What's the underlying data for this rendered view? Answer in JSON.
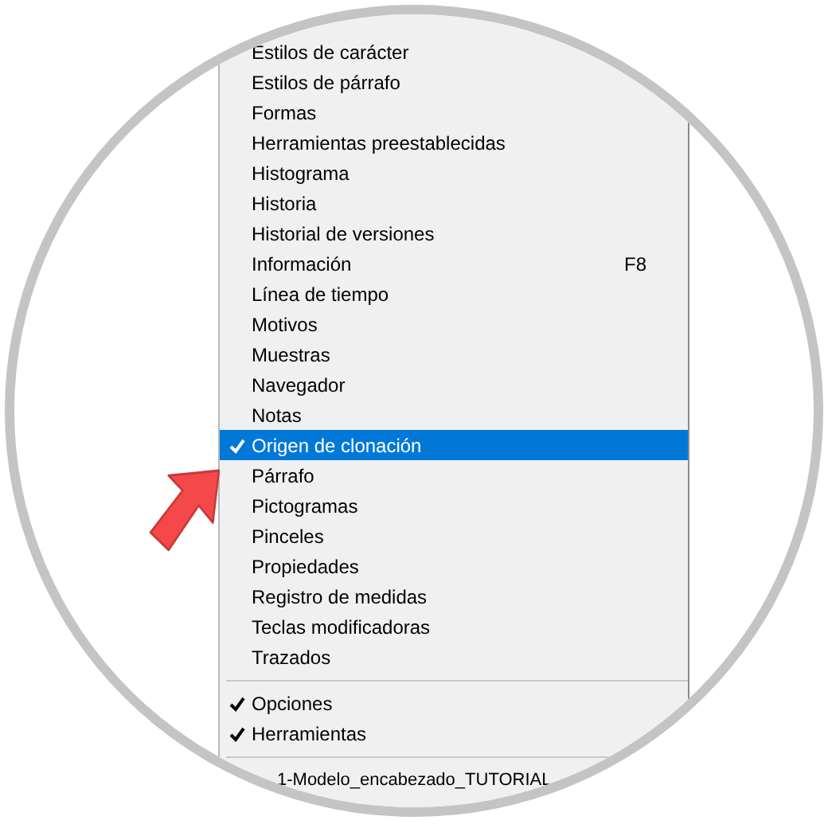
{
  "menu": {
    "items": [
      {
        "kind": "item",
        "label": "Estilos de carácter",
        "checked": false,
        "selected": false
      },
      {
        "kind": "item",
        "label": "Estilos de párrafo",
        "checked": false,
        "selected": false
      },
      {
        "kind": "item",
        "label": "Formas",
        "checked": false,
        "selected": false
      },
      {
        "kind": "item",
        "label": "Herramientas preestablecidas",
        "checked": false,
        "selected": false
      },
      {
        "kind": "item",
        "label": "Histograma",
        "checked": false,
        "selected": false
      },
      {
        "kind": "item",
        "label": "Historia",
        "checked": false,
        "selected": false
      },
      {
        "kind": "item",
        "label": "Historial de versiones",
        "checked": false,
        "selected": false
      },
      {
        "kind": "item",
        "label": "Información",
        "shortcut": "F8",
        "checked": false,
        "selected": false
      },
      {
        "kind": "item",
        "label": "Línea de tiempo",
        "checked": false,
        "selected": false
      },
      {
        "kind": "item",
        "label": "Motivos",
        "checked": false,
        "selected": false
      },
      {
        "kind": "item",
        "label": "Muestras",
        "checked": false,
        "selected": false
      },
      {
        "kind": "item",
        "label": "Navegador",
        "checked": false,
        "selected": false
      },
      {
        "kind": "item",
        "label": "Notas",
        "checked": false,
        "selected": false
      },
      {
        "kind": "item",
        "label": "Origen de clonación",
        "checked": true,
        "selected": true
      },
      {
        "kind": "item",
        "label": "Párrafo",
        "checked": false,
        "selected": false
      },
      {
        "kind": "item",
        "label": "Pictogramas",
        "checked": false,
        "selected": false
      },
      {
        "kind": "item",
        "label": "Pinceles",
        "checked": false,
        "selected": false
      },
      {
        "kind": "item",
        "label": "Propiedades",
        "checked": false,
        "selected": false
      },
      {
        "kind": "item",
        "label": "Registro de medidas",
        "checked": false,
        "selected": false
      },
      {
        "kind": "item",
        "label": "Teclas modificadoras",
        "checked": false,
        "selected": false
      },
      {
        "kind": "item",
        "label": "Trazados",
        "checked": false,
        "selected": false
      },
      {
        "kind": "separator"
      },
      {
        "kind": "item",
        "label": "Opciones",
        "checked": true,
        "selected": false
      },
      {
        "kind": "item",
        "label": "Herramientas",
        "checked": true,
        "selected": false
      },
      {
        "kind": "separator"
      },
      {
        "kind": "file",
        "label": "1-Modelo_encabezado_TUTORIAL"
      }
    ]
  }
}
